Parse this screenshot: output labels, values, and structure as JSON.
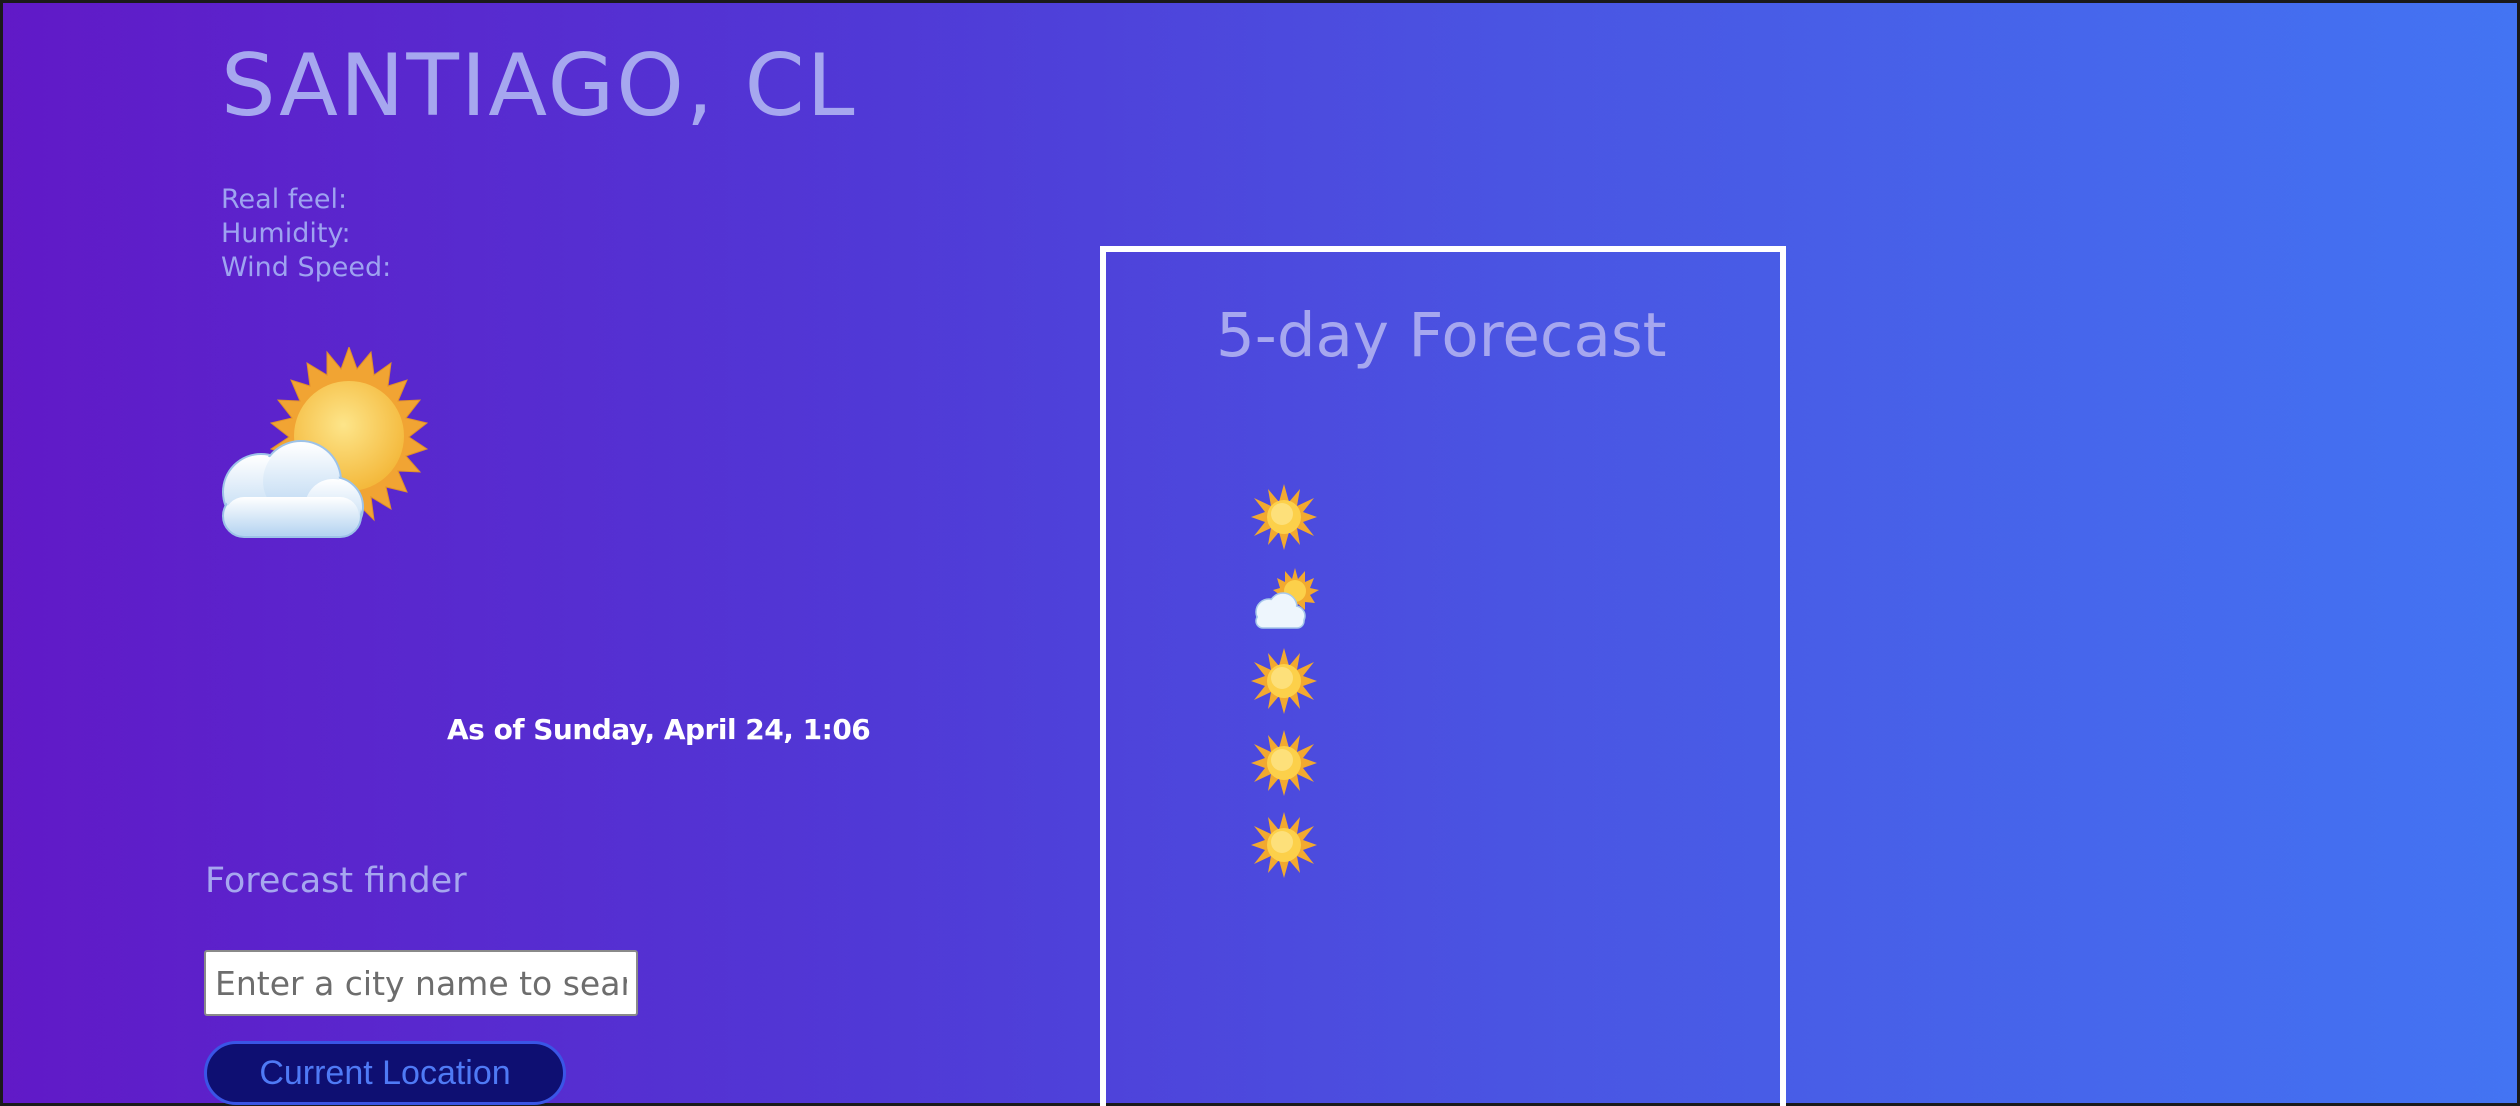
{
  "location": {
    "title": "SANTIAGO, CL"
  },
  "details": {
    "real_feel_label": "Real feel:",
    "humidity_label": "Humidity:",
    "wind_speed_label": "Wind Speed:"
  },
  "current": {
    "icon": "sun-behind-cloud-icon",
    "as_of": "As of Sunday, April 24, 1:06"
  },
  "finder": {
    "title": "Forecast finder",
    "search_placeholder": "Enter a city name to search",
    "search_value": "",
    "location_button_label": "Current Location"
  },
  "forecast": {
    "title": "5-day Forecast",
    "days": [
      {
        "icon": "sun-icon"
      },
      {
        "icon": "sun-behind-cloud-icon"
      },
      {
        "icon": "sun-icon"
      },
      {
        "icon": "sun-icon"
      },
      {
        "icon": "sun-icon"
      }
    ]
  },
  "colors": {
    "background_start": "#6119c7",
    "background_end": "#4374f3",
    "heading_text": "#a6a7ef",
    "button_bg": "#0e0f72",
    "button_text": "#4f7af5",
    "panel_border": "#ffffff"
  }
}
